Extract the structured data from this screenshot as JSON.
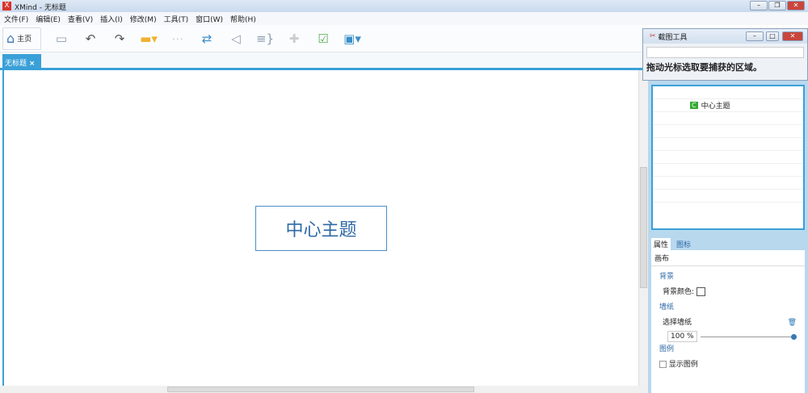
{
  "window": {
    "title": "XMind - 无标题",
    "logo": "X"
  },
  "menu": [
    "文件(F)",
    "编辑(E)",
    "查看(V)",
    "插入(I)",
    "修改(M)",
    "工具(T)",
    "窗口(W)",
    "帮助(H)"
  ],
  "toolbar": {
    "home_label": "主页"
  },
  "tab": {
    "label": "无标题",
    "close": "×"
  },
  "canvas": {
    "central_topic": "中心主题"
  },
  "snipping_tool": {
    "title": "截图工具",
    "hint": "拖动光标选取要捕获的区域。"
  },
  "outline": {
    "item": "中心主题",
    "item_badge": "C"
  },
  "properties": {
    "tabs": [
      "属性",
      "图标"
    ],
    "header": "画布",
    "background_section": "背景",
    "background_color_label": "背景颜色:",
    "wallpaper_section": "墙纸",
    "wallpaper_choice": "选择墙纸",
    "opacity": "100 %",
    "legend_section": "图例",
    "show_legend": "显示图例"
  }
}
